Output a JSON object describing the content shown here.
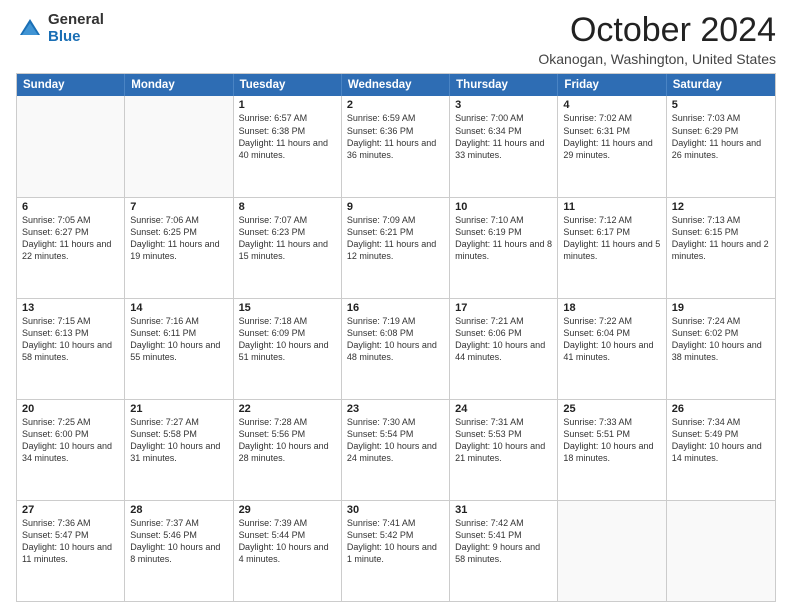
{
  "logo": {
    "general": "General",
    "blue": "Blue"
  },
  "title": "October 2024",
  "location": "Okanogan, Washington, United States",
  "days": [
    "Sunday",
    "Monday",
    "Tuesday",
    "Wednesday",
    "Thursday",
    "Friday",
    "Saturday"
  ],
  "rows": [
    [
      {
        "day": "",
        "text": ""
      },
      {
        "day": "",
        "text": ""
      },
      {
        "day": "1",
        "text": "Sunrise: 6:57 AM\nSunset: 6:38 PM\nDaylight: 11 hours and 40 minutes."
      },
      {
        "day": "2",
        "text": "Sunrise: 6:59 AM\nSunset: 6:36 PM\nDaylight: 11 hours and 36 minutes."
      },
      {
        "day": "3",
        "text": "Sunrise: 7:00 AM\nSunset: 6:34 PM\nDaylight: 11 hours and 33 minutes."
      },
      {
        "day": "4",
        "text": "Sunrise: 7:02 AM\nSunset: 6:31 PM\nDaylight: 11 hours and 29 minutes."
      },
      {
        "day": "5",
        "text": "Sunrise: 7:03 AM\nSunset: 6:29 PM\nDaylight: 11 hours and 26 minutes."
      }
    ],
    [
      {
        "day": "6",
        "text": "Sunrise: 7:05 AM\nSunset: 6:27 PM\nDaylight: 11 hours and 22 minutes."
      },
      {
        "day": "7",
        "text": "Sunrise: 7:06 AM\nSunset: 6:25 PM\nDaylight: 11 hours and 19 minutes."
      },
      {
        "day": "8",
        "text": "Sunrise: 7:07 AM\nSunset: 6:23 PM\nDaylight: 11 hours and 15 minutes."
      },
      {
        "day": "9",
        "text": "Sunrise: 7:09 AM\nSunset: 6:21 PM\nDaylight: 11 hours and 12 minutes."
      },
      {
        "day": "10",
        "text": "Sunrise: 7:10 AM\nSunset: 6:19 PM\nDaylight: 11 hours and 8 minutes."
      },
      {
        "day": "11",
        "text": "Sunrise: 7:12 AM\nSunset: 6:17 PM\nDaylight: 11 hours and 5 minutes."
      },
      {
        "day": "12",
        "text": "Sunrise: 7:13 AM\nSunset: 6:15 PM\nDaylight: 11 hours and 2 minutes."
      }
    ],
    [
      {
        "day": "13",
        "text": "Sunrise: 7:15 AM\nSunset: 6:13 PM\nDaylight: 10 hours and 58 minutes."
      },
      {
        "day": "14",
        "text": "Sunrise: 7:16 AM\nSunset: 6:11 PM\nDaylight: 10 hours and 55 minutes."
      },
      {
        "day": "15",
        "text": "Sunrise: 7:18 AM\nSunset: 6:09 PM\nDaylight: 10 hours and 51 minutes."
      },
      {
        "day": "16",
        "text": "Sunrise: 7:19 AM\nSunset: 6:08 PM\nDaylight: 10 hours and 48 minutes."
      },
      {
        "day": "17",
        "text": "Sunrise: 7:21 AM\nSunset: 6:06 PM\nDaylight: 10 hours and 44 minutes."
      },
      {
        "day": "18",
        "text": "Sunrise: 7:22 AM\nSunset: 6:04 PM\nDaylight: 10 hours and 41 minutes."
      },
      {
        "day": "19",
        "text": "Sunrise: 7:24 AM\nSunset: 6:02 PM\nDaylight: 10 hours and 38 minutes."
      }
    ],
    [
      {
        "day": "20",
        "text": "Sunrise: 7:25 AM\nSunset: 6:00 PM\nDaylight: 10 hours and 34 minutes."
      },
      {
        "day": "21",
        "text": "Sunrise: 7:27 AM\nSunset: 5:58 PM\nDaylight: 10 hours and 31 minutes."
      },
      {
        "day": "22",
        "text": "Sunrise: 7:28 AM\nSunset: 5:56 PM\nDaylight: 10 hours and 28 minutes."
      },
      {
        "day": "23",
        "text": "Sunrise: 7:30 AM\nSunset: 5:54 PM\nDaylight: 10 hours and 24 minutes."
      },
      {
        "day": "24",
        "text": "Sunrise: 7:31 AM\nSunset: 5:53 PM\nDaylight: 10 hours and 21 minutes."
      },
      {
        "day": "25",
        "text": "Sunrise: 7:33 AM\nSunset: 5:51 PM\nDaylight: 10 hours and 18 minutes."
      },
      {
        "day": "26",
        "text": "Sunrise: 7:34 AM\nSunset: 5:49 PM\nDaylight: 10 hours and 14 minutes."
      }
    ],
    [
      {
        "day": "27",
        "text": "Sunrise: 7:36 AM\nSunset: 5:47 PM\nDaylight: 10 hours and 11 minutes."
      },
      {
        "day": "28",
        "text": "Sunrise: 7:37 AM\nSunset: 5:46 PM\nDaylight: 10 hours and 8 minutes."
      },
      {
        "day": "29",
        "text": "Sunrise: 7:39 AM\nSunset: 5:44 PM\nDaylight: 10 hours and 4 minutes."
      },
      {
        "day": "30",
        "text": "Sunrise: 7:41 AM\nSunset: 5:42 PM\nDaylight: 10 hours and 1 minute."
      },
      {
        "day": "31",
        "text": "Sunrise: 7:42 AM\nSunset: 5:41 PM\nDaylight: 9 hours and 58 minutes."
      },
      {
        "day": "",
        "text": ""
      },
      {
        "day": "",
        "text": ""
      }
    ]
  ]
}
